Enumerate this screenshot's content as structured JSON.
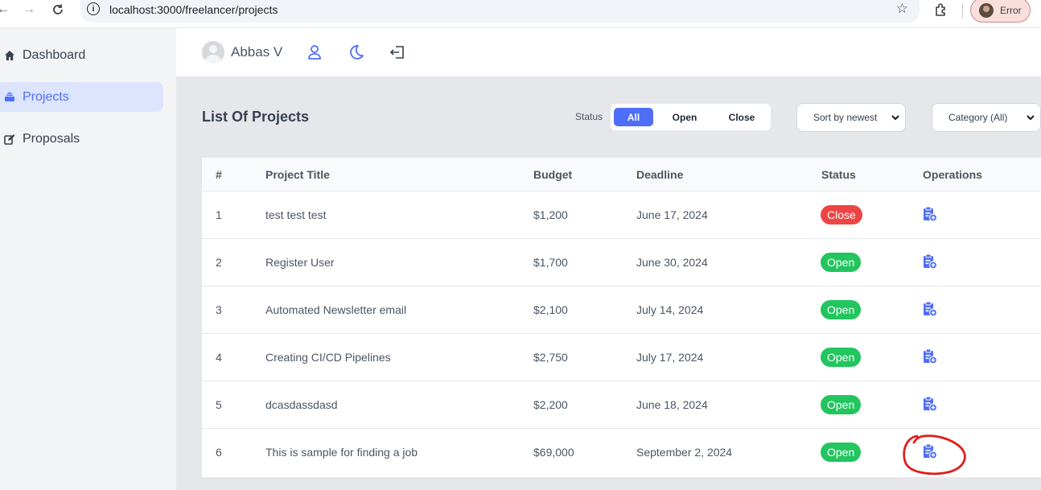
{
  "browser": {
    "url": "localhost:3000/freelancer/projects",
    "profile_label": "Error"
  },
  "sidebar": {
    "items": [
      {
        "label": "Dashboard",
        "icon": "home-icon"
      },
      {
        "label": "Projects",
        "icon": "layers-icon",
        "active": true
      },
      {
        "label": "Proposals",
        "icon": "edit-icon"
      }
    ]
  },
  "header": {
    "user_name": "Abbas V"
  },
  "main": {
    "title": "List Of Projects",
    "status_label": "Status",
    "status_filter": [
      "All",
      "Open",
      "Close"
    ],
    "status_selected": "All",
    "sort_value": "Sort by newest",
    "category_value": "Category (All)"
  },
  "table": {
    "headers": [
      "#",
      "Project Title",
      "Budget",
      "Deadline",
      "Status",
      "Operations"
    ],
    "rows": [
      {
        "num": "1",
        "title": "test test test",
        "budget": "$1,200",
        "deadline": "June 17, 2024",
        "status": "Close"
      },
      {
        "num": "2",
        "title": "Register User",
        "budget": "$1,700",
        "deadline": "June 30, 2024",
        "status": "Open"
      },
      {
        "num": "3",
        "title": "Automated Newsletter email",
        "budget": "$2,100",
        "deadline": "July 14, 2024",
        "status": "Open"
      },
      {
        "num": "4",
        "title": "Creating CI/CD Pipelines",
        "budget": "$2,750",
        "deadline": "July 17, 2024",
        "status": "Open"
      },
      {
        "num": "5",
        "title": "dcasdassdasd",
        "budget": "$2,200",
        "deadline": "June 18, 2024",
        "status": "Open"
      },
      {
        "num": "6",
        "title": "This is sample for finding a job",
        "budget": "$69,000",
        "deadline": "September 2, 2024",
        "status": "Open"
      }
    ]
  },
  "colors": {
    "accent": "#4f6ef7",
    "open": "#22c55e",
    "close": "#ef4444",
    "annotation": "#e11d1d"
  }
}
